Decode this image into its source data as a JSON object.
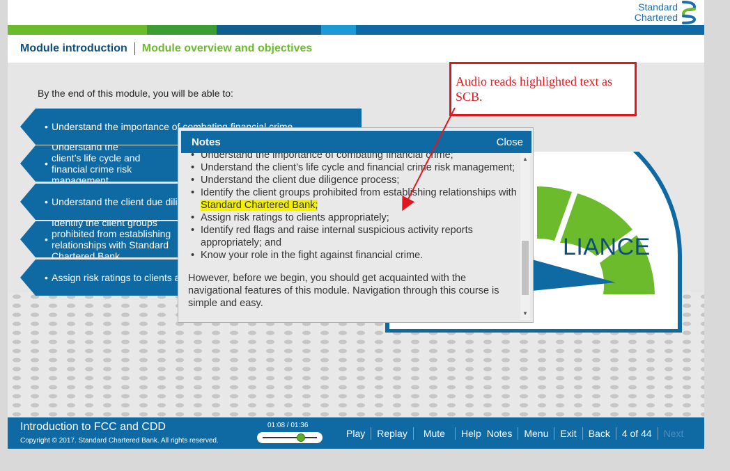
{
  "brand": {
    "logo_line1": "Standard",
    "logo_line2": "Chartered",
    "stripe_colors": [
      "#6cbb2d",
      "#3e9c34",
      "#0f5f8f",
      "#0f6aa4",
      "#1d9ad6",
      "#0f6aa4"
    ]
  },
  "breadcrumb": {
    "module": "Module introduction",
    "page": "Module overview and objectives"
  },
  "intro": "By the end of this module, you will be able to:",
  "objectives": [
    {
      "text": "Understand the importance of combating financial crime"
    },
    {
      "text": "Understand the client’s life cycle and financial crime risk management"
    },
    {
      "text": "Understand the client due diligence process"
    },
    {
      "text": "Identify the client groups prohibited from establishing relationships with Standard Chartered Bank"
    },
    {
      "text": "Assign risk ratings to clients appropriately"
    }
  ],
  "objective_bullet": "•",
  "gauge": {
    "label": "LIANCE",
    "accent": "#6cbb2d",
    "frame": "#0f6aa4"
  },
  "notes": {
    "title": "Notes",
    "close": "Close",
    "items": [
      "Understand the importance of combating financial crime;",
      "Understand the client’s life cycle and financial crime risk management;",
      "Understand the client due diligence process;",
      "Identify the client groups prohibited from establishing relationships with",
      "Assign risk ratings to clients appropriately;",
      "Identify red flags and raise internal suspicious activity reports appropriately; and",
      "Know your role in the fight against financial crime."
    ],
    "highlighted": "Standard Chartered Bank;",
    "paragraph": "However, before we begin, you should get acquainted with the navigational features of this module. Navigation through this course is simple and easy.",
    "scroll_up": "▲",
    "scroll_down": "▼"
  },
  "callout": {
    "text": "Audio reads highlighted text as SCB.",
    "color": "#e0181e"
  },
  "footer": {
    "course_title": "Introduction to FCC and CDD",
    "copyright": "Copyright © 2017. Standard Chartered Bank. All rights reserved.",
    "time": "01:08 / 01:36",
    "progress": 0.71,
    "nav": {
      "play": "Play",
      "replay": "Replay",
      "mute": "Mute",
      "help": "Help",
      "notes": "Notes",
      "menu": "Menu",
      "exit": "Exit",
      "back": "Back",
      "page": "4 of 44",
      "next": "Next"
    }
  }
}
